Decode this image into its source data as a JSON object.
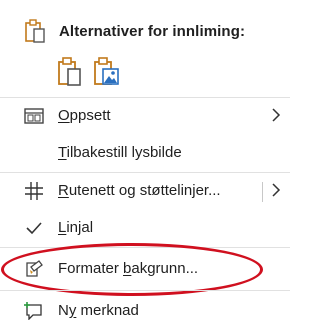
{
  "paste_options": {
    "title": "Alternativer for innliming:",
    "buttons": [
      {
        "icon": "clipboard-paste-icon"
      },
      {
        "icon": "paste-as-picture-icon"
      }
    ]
  },
  "items": [
    {
      "label_u": "O",
      "label_rest": "ppsett",
      "icon": "layout-icon",
      "has_submenu": true
    },
    {
      "label_u": "T",
      "label_rest": "ilbakestill lysbilde",
      "icon": "",
      "has_submenu": false
    },
    {
      "label_u": "R",
      "label_rest": "utenett og støttelinjer...",
      "icon": "grid-icon",
      "has_submenu": true
    },
    {
      "label_pre": "",
      "label_u": "L",
      "label_rest": "injal",
      "icon": "checkmark-icon",
      "has_submenu": false
    },
    {
      "label_pre": "Formater ",
      "label_u": "b",
      "label_rest": "akgrunn...",
      "icon": "format-background-icon",
      "has_submenu": false
    },
    {
      "label_pre": "N",
      "label_u": "y",
      "label_rest": " merknad",
      "icon": "new-comment-icon",
      "has_submenu": false
    }
  ],
  "colors": {
    "accent": "#d08e1f",
    "picture_blue": "#2a6fbf",
    "highlight_circle": "#d0101f"
  }
}
